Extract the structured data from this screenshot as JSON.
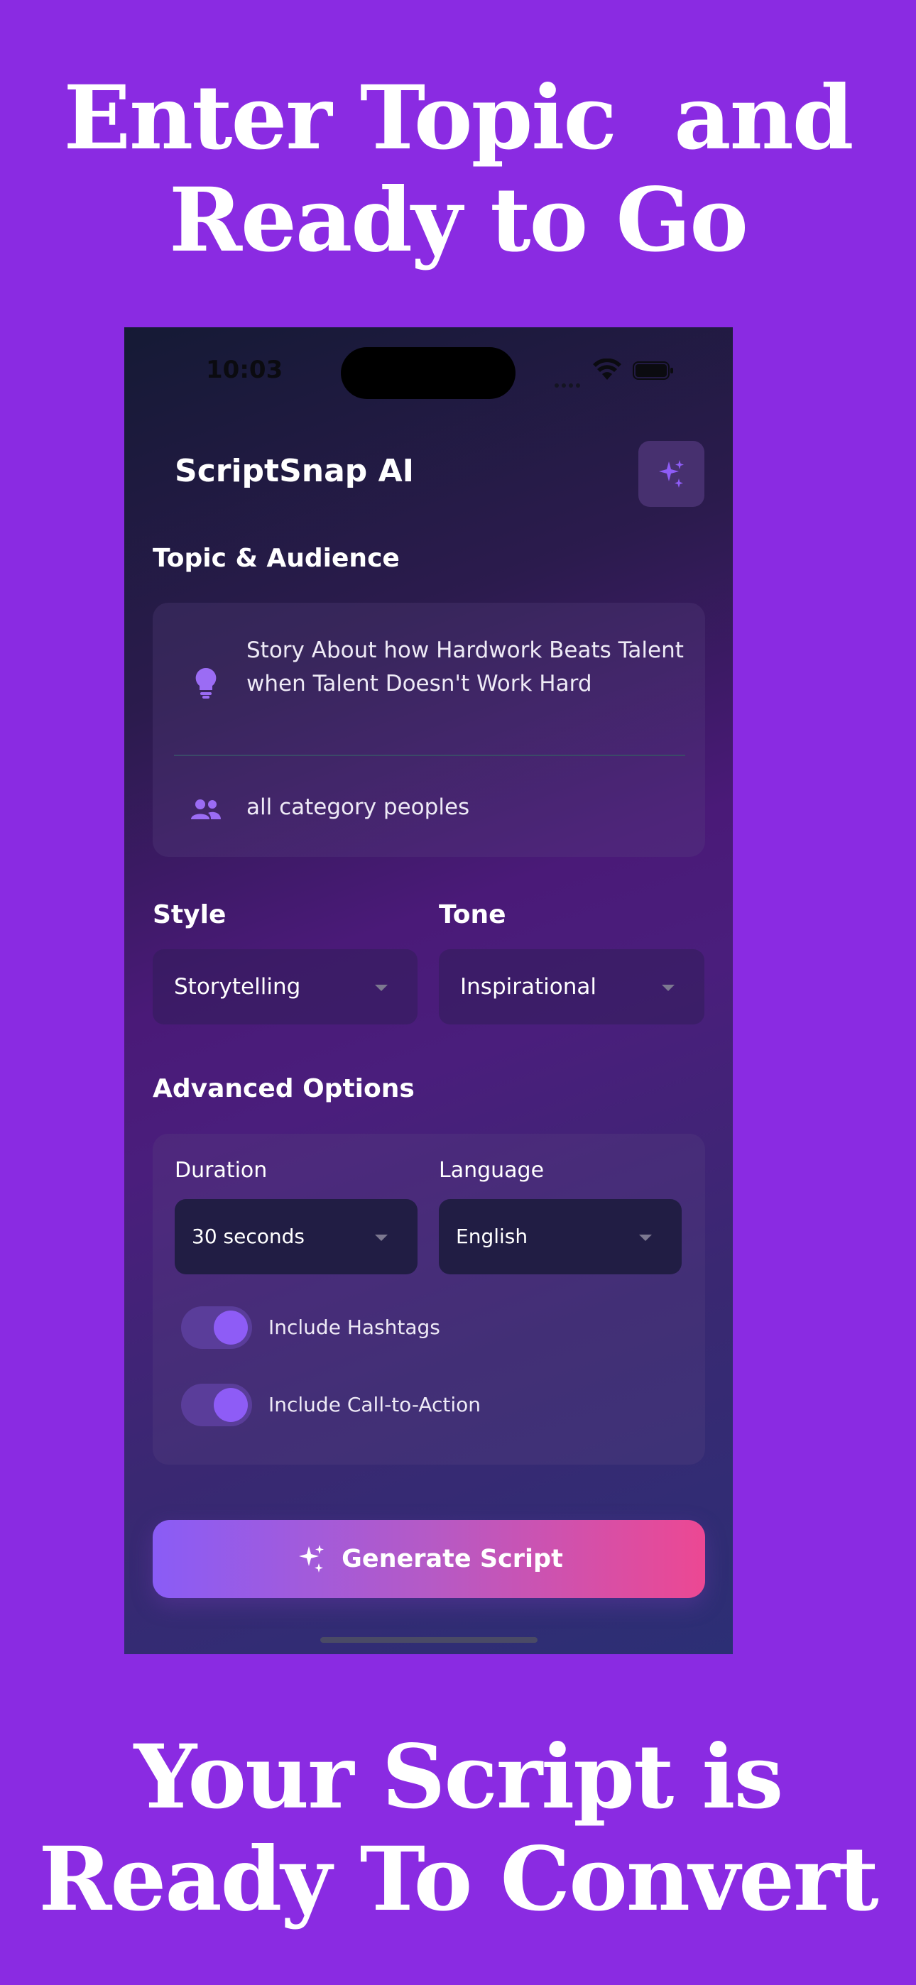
{
  "promo": {
    "top_line1": "Enter Topic  and",
    "top_line2": "Ready to Go",
    "bottom_line1": "Your Script is",
    "bottom_line2": "Ready To Convert"
  },
  "status_bar": {
    "time": "10:03"
  },
  "app": {
    "title": "ScriptSnap AI",
    "header_icon": "sparkles-icon"
  },
  "topic_section": {
    "title": "Topic & Audience",
    "topic_value": "Story About how Hardwork Beats Talent when Talent Doesn't Work Hard",
    "topic_icon": "lightbulb-icon",
    "audience_value": "all category peoples",
    "audience_icon": "people-icon"
  },
  "style": {
    "label": "Style",
    "value": "Storytelling"
  },
  "tone": {
    "label": "Tone",
    "value": "Inspirational"
  },
  "advanced": {
    "title": "Advanced Options",
    "duration_label": "Duration",
    "duration_value": "30 seconds",
    "language_label": "Language",
    "language_value": "English",
    "hashtags_label": "Include Hashtags",
    "hashtags_on": true,
    "cta_label": "Include Call-to-Action",
    "cta_on": true
  },
  "generate": {
    "label": "Generate Script"
  },
  "colors": {
    "background": "#8a2be2",
    "accent": "#8e5cf6",
    "button_gradient_start": "#8a5cf6",
    "button_gradient_end": "#ec4893"
  }
}
